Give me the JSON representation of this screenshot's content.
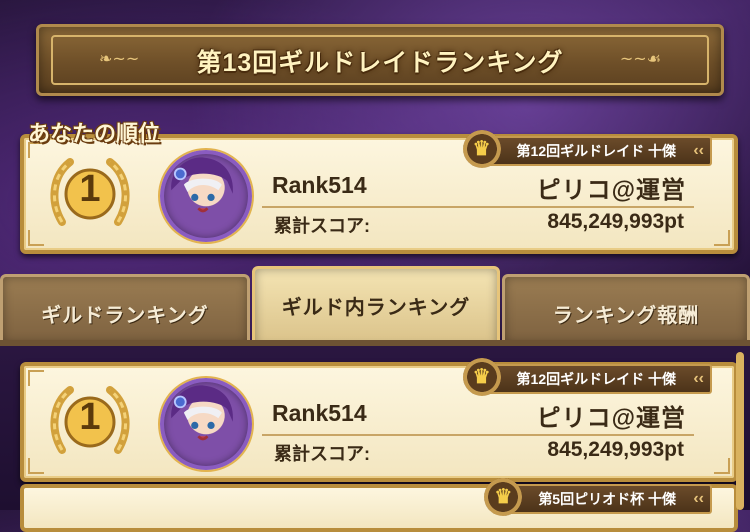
{
  "banner": {
    "title": "第13回ギルドレイドランキング"
  },
  "my_rank": {
    "label": "あなたの順位",
    "rank": "1",
    "title_badge": "第12回ギルドレイド 十傑",
    "name": "Rank514",
    "guild": "ピリコ@運営",
    "score_label": "累計スコア:",
    "score_value": "845,249,993pt"
  },
  "tabs": [
    {
      "label": "ギルドランキング",
      "active": false
    },
    {
      "label": "ギルド内ランキング",
      "active": true
    },
    {
      "label": "ランキング報酬",
      "active": false
    }
  ],
  "list": [
    {
      "rank": "1",
      "title_badge": "第12回ギルドレイド 十傑",
      "name": "Rank514",
      "guild": "ピリコ@運営",
      "score_label": "累計スコア:",
      "score_value": "845,249,993pt"
    },
    {
      "title_badge": "第5回ピリオド杯 十傑"
    }
  ],
  "colors": {
    "gold": "#d4a23a",
    "parchment": "#f8eed2",
    "wood": "#7e6240"
  }
}
